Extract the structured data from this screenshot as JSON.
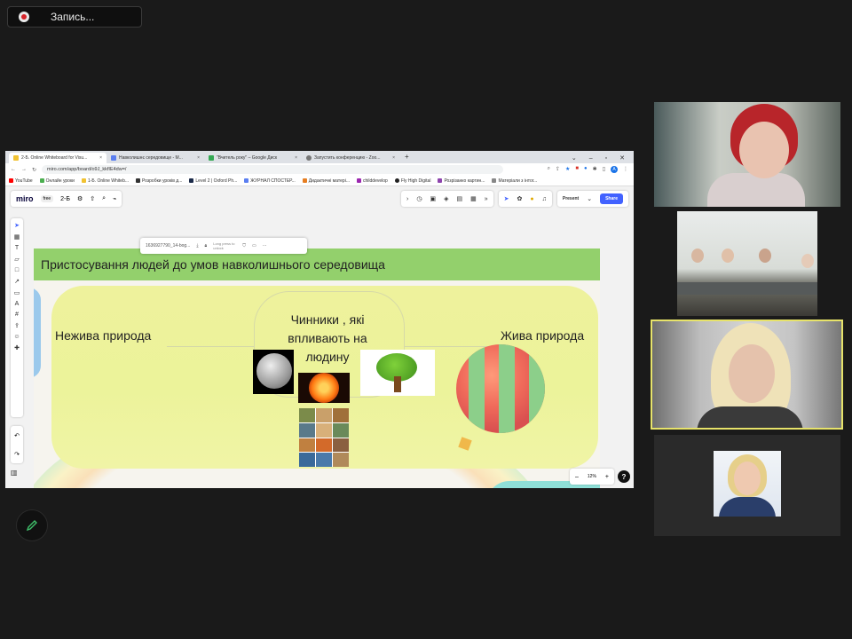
{
  "recording": {
    "label": "Запись..."
  },
  "browser": {
    "tabs": [
      {
        "title": "2-Б. Online Whiteboard for Visu...",
        "active": true
      },
      {
        "title": "Навколишнє середовище - М..."
      },
      {
        "title": "\"Вчитель року\" – Google Диск"
      },
      {
        "title": "Запустить конференцию - Zoo..."
      }
    ],
    "url": "miro.com/app/board/o9J_kkfIE4dw=/",
    "avatar_letter": "A",
    "bookmarks": [
      "YouTube",
      "Онлайн уроки",
      "1-Б. Online Whiteb...",
      "Розробки уроків д...",
      "Level 2 | Oxford Ph...",
      "ЖУРНАЛ СПОСТЕР...",
      "Дидактичні матері...",
      "childdevelop",
      "Fly High Digital",
      "Розрізанко картин...",
      "Матеріали з інтог..."
    ]
  },
  "miro": {
    "logo": "miro",
    "plan": "free",
    "board_name": "2-Б",
    "present_label": "Present",
    "share_label": "Share",
    "zoom_level": "12%",
    "zoom_minus": "–",
    "zoom_plus": "+",
    "help": "?",
    "file_info": {
      "name": "1636927790_14-bog...",
      "lock_hint": "Long press to unlock"
    }
  },
  "frame": {
    "title": "Пристосування людей до умов навколишнього середовища",
    "left_node": "Нежива природа",
    "center_node": "Чинники , які впливають на людину",
    "right_node": "Жива природа"
  },
  "colors": {
    "header_green": "#93d06c",
    "blob_yellow": "#ecf39a",
    "active_tile_border": "#e7e36a",
    "miro_blue": "#4262ff"
  }
}
